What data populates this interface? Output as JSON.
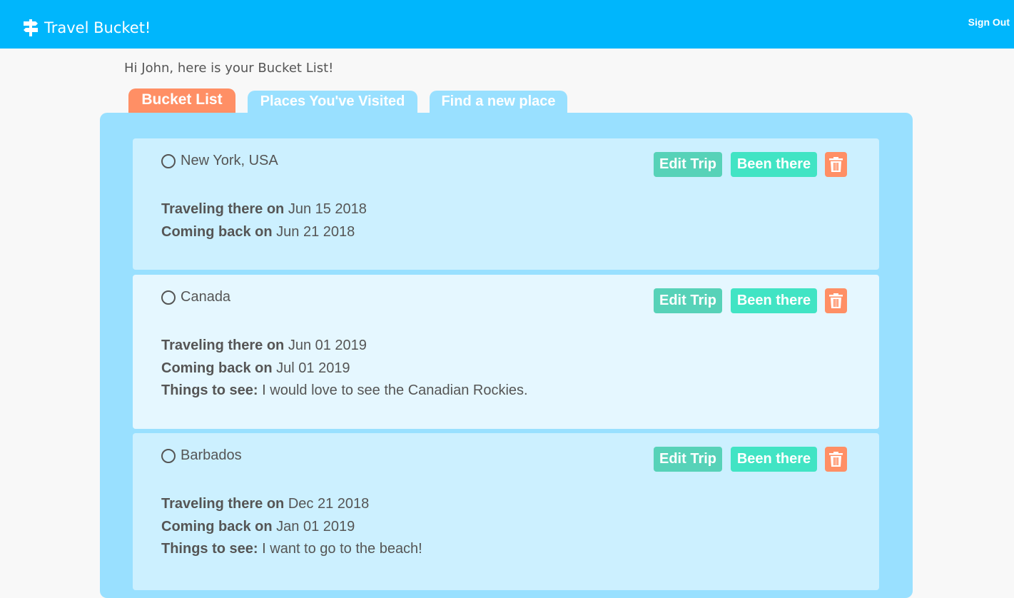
{
  "nav": {
    "brand": "Travel Bucket!",
    "signout": "Sign Out"
  },
  "greeting": "Hi John, here is your Bucket List!",
  "tabs": [
    "Bucket List",
    "Places You've Visited",
    "Find a new place"
  ],
  "actions": {
    "edit": "Edit Trip",
    "been": "Been there"
  },
  "labels": {
    "depart": "Traveling there on",
    "return": "Coming back on",
    "see": "Things to see:"
  },
  "trips": [
    {
      "destination": "New York, USA",
      "depart": "Jun 15 2018",
      "return": "Jun 21 2018"
    },
    {
      "destination": "Canada",
      "depart": "Jun 01 2019",
      "return": "Jul 01 2019",
      "see": "I would love to see the Canadian Rockies."
    },
    {
      "destination": "Barbados",
      "depart": "Dec 21 2018",
      "return": "Jan 01 2019",
      "see": "I want to go to the beach!"
    }
  ],
  "colors": {
    "navbar": "#00b6fc",
    "active_tab": "#ff8f65",
    "inactive_tab": "#99e0ff",
    "panel": "#99e0ff",
    "card": "#ccf0ff",
    "card_alt": "#e5f7ff",
    "edit_button": "#57d2b8",
    "been_button": "#41e4c4",
    "trash_button": "#ff8f65"
  },
  "icons": {
    "brand": "signpost-icon",
    "complete": "circle-checkbox-icon",
    "delete": "trash-icon"
  }
}
